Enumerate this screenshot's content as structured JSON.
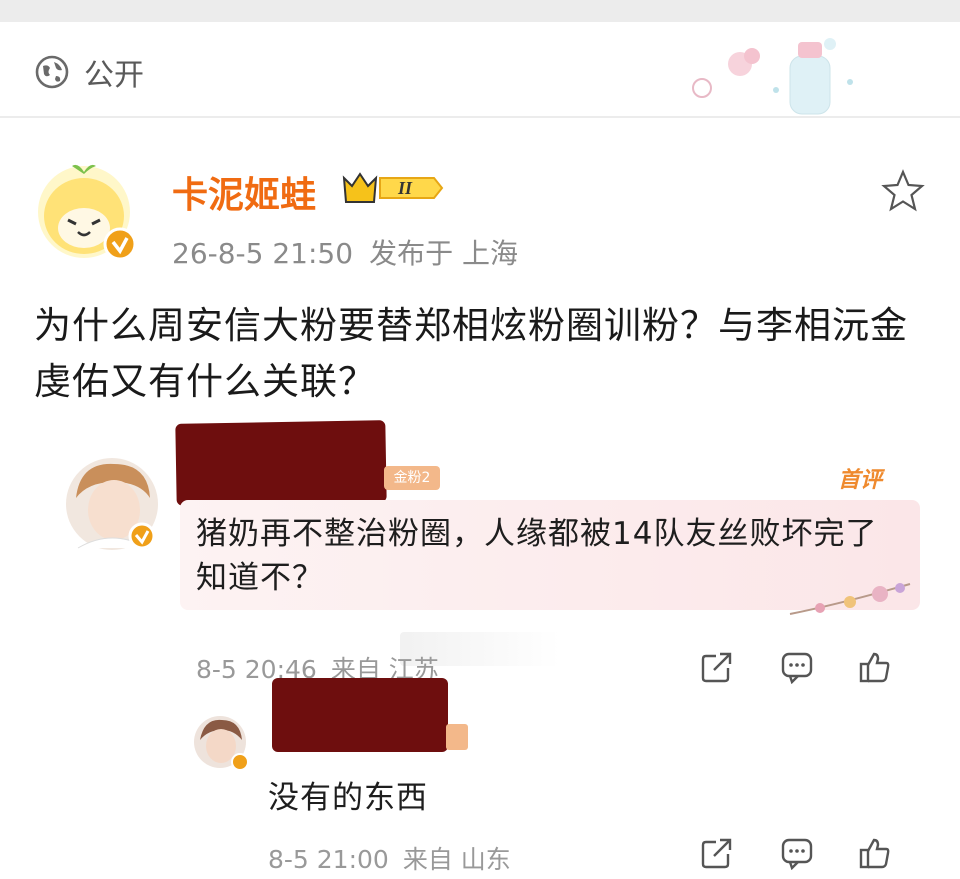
{
  "visibility": {
    "label": "公开",
    "icon": "globe-icon"
  },
  "post": {
    "author": "卡泥姬蛙",
    "level_badge": "II",
    "date": "26-8-5 21:50",
    "published_in": "发布于 上海",
    "text": "为什么周安信大粉要替郑相炫粉圈训粉？与李相沅金虔佑又有什么关联？",
    "favorite_icon": "star-icon"
  },
  "comments": [
    {
      "fan_badge": "金粉2",
      "tag": "首评",
      "text": "猪奶再不整治粉圈，人缘都被14队友丝败坏完了知道不？",
      "date": "8-5 20:46",
      "from": "来自 江苏",
      "actions": [
        "share-icon",
        "comment-icon",
        "like-icon"
      ]
    },
    {
      "text": "没有的东西",
      "date": "8-5 21:00",
      "from": "来自 山东",
      "actions": [
        "share-icon",
        "comment-icon",
        "like-icon"
      ]
    }
  ],
  "colors": {
    "author": "#f06b12",
    "accent": "#ef8a2e",
    "redaction": "#6e0e0e",
    "verified": "#f0a019"
  }
}
